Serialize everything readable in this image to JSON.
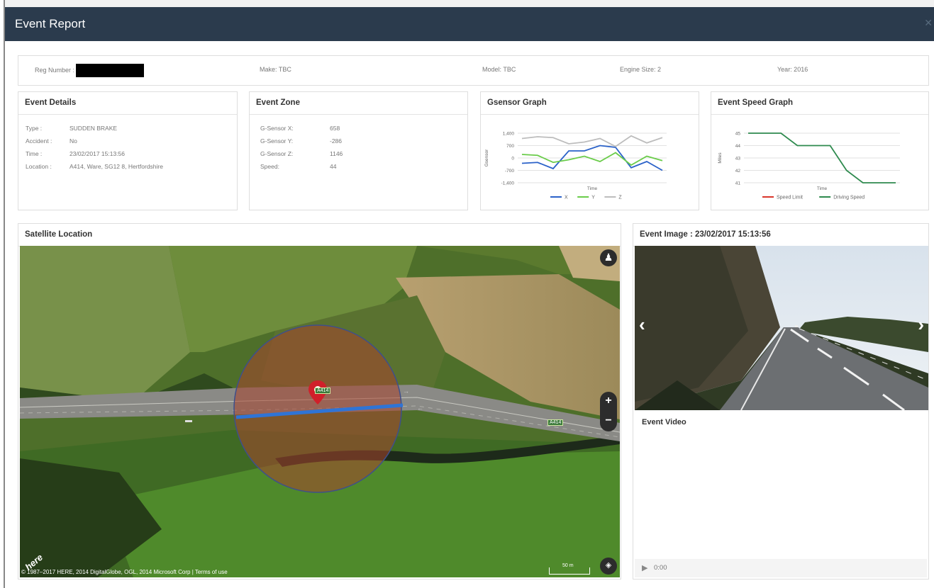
{
  "header": {
    "title": "Event Report",
    "close_icon": "close-icon"
  },
  "vehicle": {
    "reg_label": "Reg Number :",
    "make": "Make: TBC",
    "model": "Model: TBC",
    "engine": "Engine Size: 2",
    "year": "Year: 2016"
  },
  "event_details": {
    "title": "Event Details",
    "rows": [
      {
        "key": "Type :",
        "value": "SUDDEN BRAKE"
      },
      {
        "key": "Accident :",
        "value": "No"
      },
      {
        "key": "Time :",
        "value": "23/02/2017 15:13:56"
      },
      {
        "key": "Location :",
        "value": "A414, Ware, SG12 8, Hertfordshire"
      }
    ]
  },
  "event_zone": {
    "title": "Event Zone",
    "rows": [
      {
        "key": "G-Sensor X:",
        "value": "658"
      },
      {
        "key": "G-Sensor Y:",
        "value": "-286"
      },
      {
        "key": "G-Sensor Z:",
        "value": "1146"
      },
      {
        "key": "Speed:",
        "value": "44"
      }
    ]
  },
  "gsensor_graph": {
    "title": "Gsensor Graph",
    "chart_data": {
      "type": "line",
      "xlabel": "Time",
      "ylabel": "Gsensor",
      "ylim": [
        -1400,
        1400
      ],
      "yticks": [
        "1,400",
        "700",
        "0",
        "-700",
        "-1,400"
      ],
      "yticks_values": [
        1400,
        700,
        0,
        -700,
        -1400
      ],
      "grid": true,
      "legend_position": "bottom",
      "series": [
        {
          "name": "X",
          "color": "#2b62c9",
          "values": [
            -300,
            -250,
            -600,
            400,
            400,
            700,
            600,
            -550,
            -200,
            -700
          ]
        },
        {
          "name": "Y",
          "color": "#6acc4a",
          "values": [
            200,
            150,
            -250,
            -100,
            100,
            -200,
            300,
            -400,
            100,
            -150
          ]
        },
        {
          "name": "Z",
          "color": "#bdbdbd",
          "values": [
            1100,
            1200,
            1150,
            800,
            900,
            1100,
            650,
            1250,
            850,
            1150
          ]
        }
      ]
    }
  },
  "speed_graph": {
    "title": "Event Speed Graph",
    "chart_data": {
      "type": "line",
      "xlabel": "Time",
      "ylabel": "Miles",
      "ylim": [
        41,
        45
      ],
      "yticks": [
        "45",
        "44",
        "43",
        "42",
        "41"
      ],
      "yticks_values": [
        45,
        44,
        43,
        42,
        41
      ],
      "grid": true,
      "legend_position": "bottom",
      "series": [
        {
          "name": "Speed Limit",
          "color": "#d9362b",
          "values": []
        },
        {
          "name": "Driving Speed",
          "color": "#2e8a4e",
          "values": [
            45,
            45,
            45,
            44,
            44,
            44,
            42,
            41,
            41,
            41
          ]
        }
      ]
    }
  },
  "satellite": {
    "title": "Satellite Location",
    "road_label": "A414",
    "copyright": "© 1987–2017 HERE, 2014 DigitalGlobe, OGL, 2014 Microsoft Corp | Terms of use",
    "scale": "50 m",
    "logo": "here",
    "zoom_in": "+",
    "zoom_out": "−"
  },
  "event_image": {
    "title": "Event Image : 23/02/2017 15:13:56",
    "prev": "‹",
    "next": "›"
  },
  "event_video": {
    "title": "Event Video",
    "time": "0:00"
  }
}
